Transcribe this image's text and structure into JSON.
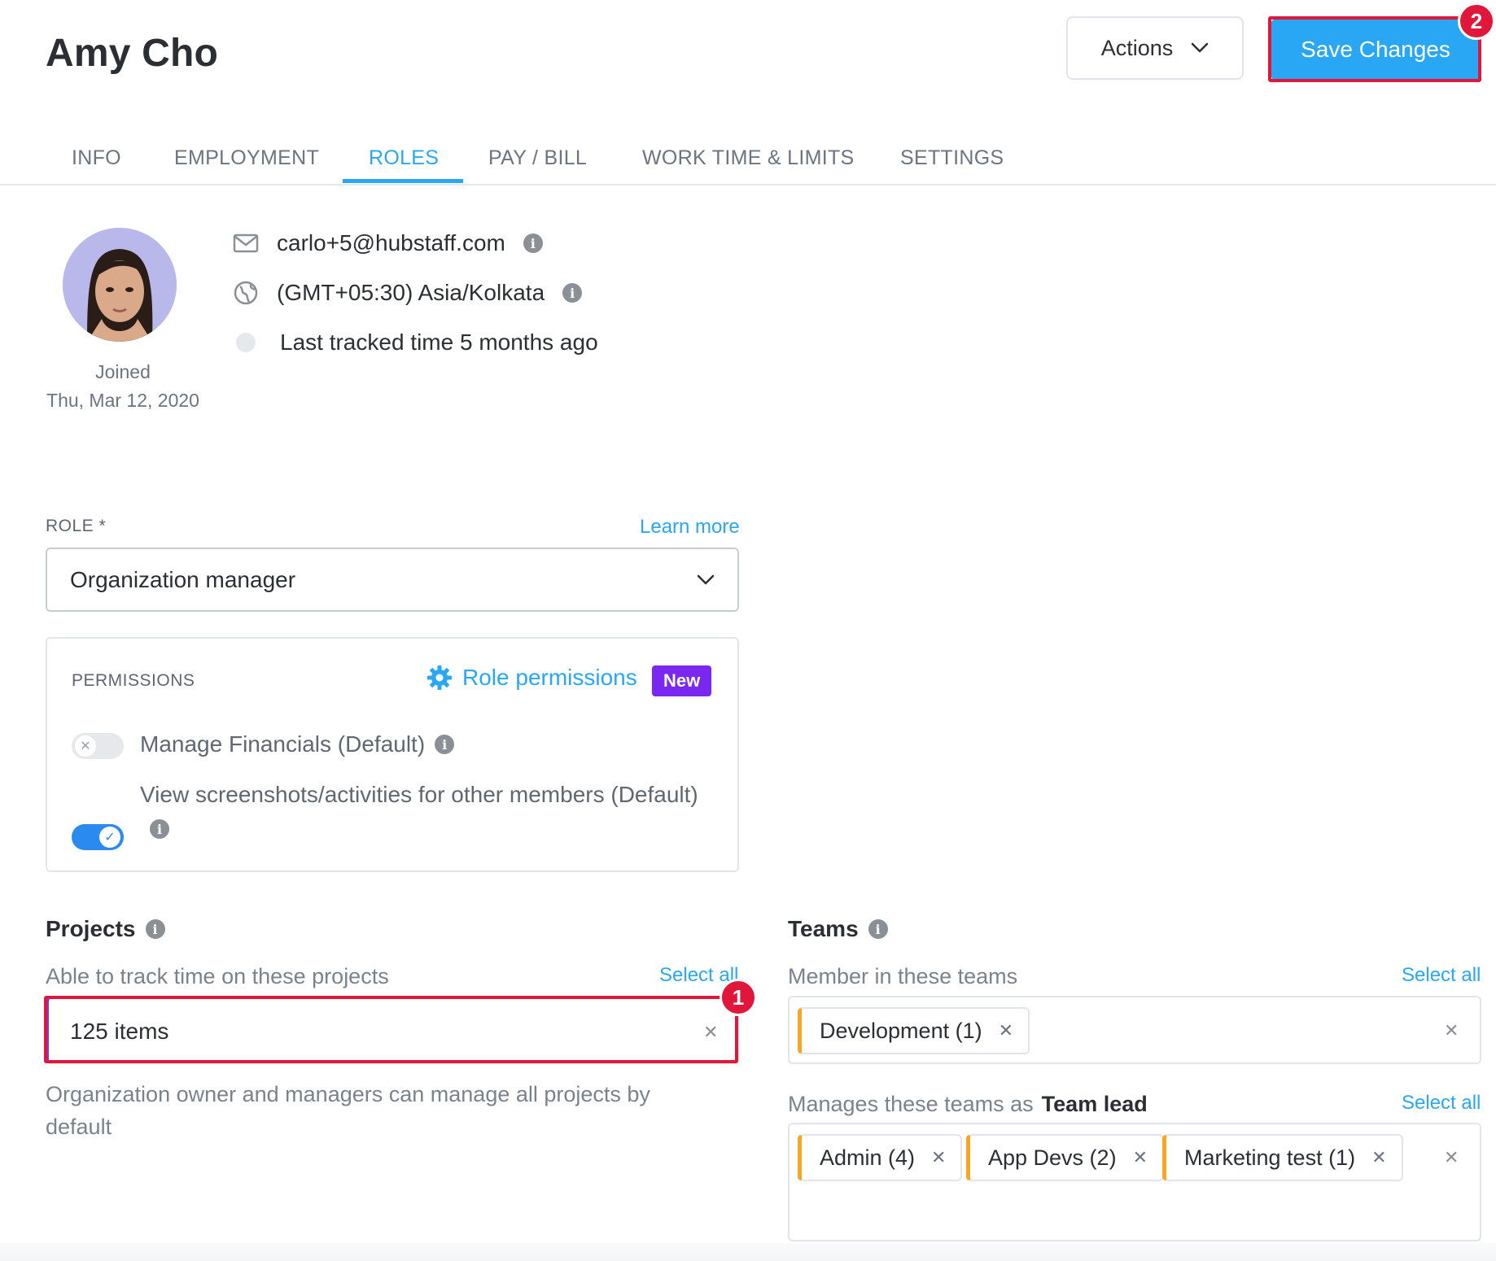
{
  "header": {
    "title": "Amy Cho",
    "actions_label": "Actions",
    "save_label": "Save Changes",
    "save_badge": "2"
  },
  "tabs": [
    {
      "label": "INFO"
    },
    {
      "label": "EMPLOYMENT"
    },
    {
      "label": "ROLES",
      "active": true
    },
    {
      "label": "PAY / BILL"
    },
    {
      "label": "WORK TIME & LIMITS"
    },
    {
      "label": "SETTINGS"
    }
  ],
  "profile": {
    "joined_label": "Joined",
    "joined_date": "Thu, Mar 12, 2020",
    "email": "carlo+5@hubstaff.com",
    "timezone": "(GMT+05:30) Asia/Kolkata",
    "last_tracked": "Last tracked time 5 months ago"
  },
  "role": {
    "label": "ROLE *",
    "learn_more": "Learn more",
    "selected": "Organization manager"
  },
  "permissions": {
    "title": "PERMISSIONS",
    "role_permissions_link": "Role permissions",
    "new_badge": "New",
    "items": [
      {
        "label": "Manage Financials (Default)",
        "enabled": false
      },
      {
        "label": "View screenshots/activities for other members (Default)",
        "enabled": true
      }
    ]
  },
  "projects": {
    "title": "Projects",
    "sub_label": "Able to track time on these projects",
    "select_all": "Select all",
    "value": "125 items",
    "badge": "1",
    "note": "Organization owner and managers can manage all projects by default"
  },
  "teams": {
    "title": "Teams",
    "member_label": "Member in these teams",
    "member_select_all": "Select all",
    "member_chips": [
      {
        "label": "Development (1)"
      }
    ],
    "lead_label_prefix": "Manages these teams as",
    "lead_label_bold": "Team lead",
    "lead_select_all": "Select all",
    "lead_chips": [
      {
        "label": "Admin (4)"
      },
      {
        "label": "App Devs (2)"
      },
      {
        "label": "Marketing test (1)"
      }
    ]
  },
  "colors": {
    "accent": "#2aa7f4",
    "highlight": "#e0163a",
    "new_badge": "#7a28f0",
    "team_chip": "#f5a623"
  }
}
